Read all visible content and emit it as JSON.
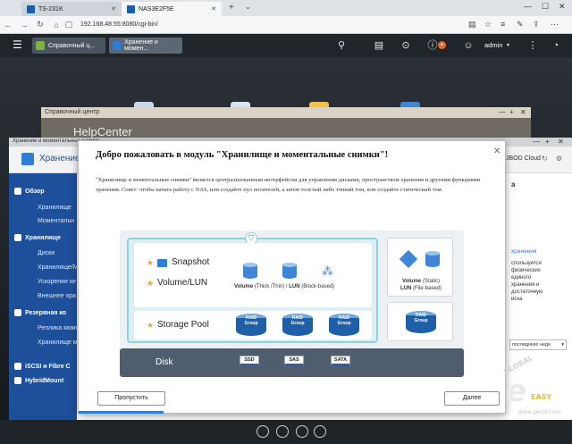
{
  "browser": {
    "tabs": [
      {
        "label": "TS-231K",
        "active": false
      },
      {
        "label": "NAS3E2F5E",
        "active": true
      }
    ],
    "address": "192.168.48.55:8080/cgi-bin/"
  },
  "qts": {
    "tabs": [
      "Справочный ц...",
      "Хранение и момен..."
    ],
    "user": "admin"
  },
  "help_window": {
    "header": "Справочный центр",
    "title": "HelpCenter"
  },
  "storage_window": {
    "header": "Хранение и моментальные снимки",
    "title": "Хранение",
    "jbod_label": "JBOD Cloud",
    "sidebar": {
      "items": [
        {
          "label": "Обзор",
          "type": "main"
        },
        {
          "label": "Хранилище",
          "type": "sub"
        },
        {
          "label": "Моментальн",
          "type": "sub"
        },
        {
          "label": "Хранилище",
          "type": "main"
        },
        {
          "label": "Диски",
          "type": "sub"
        },
        {
          "label": "Хранилище/М",
          "type": "sub"
        },
        {
          "label": "Ускорение ке",
          "type": "sub"
        },
        {
          "label": "Внешнее хра",
          "type": "sub"
        },
        {
          "label": "Резервная ко",
          "type": "main"
        },
        {
          "label": "Реплика момс",
          "type": "sub"
        },
        {
          "label": "Хранилище м",
          "type": "sub"
        },
        {
          "label": "iSCSI и Fibre C",
          "type": "main"
        },
        {
          "label": "HybridMount",
          "type": "main"
        }
      ]
    },
    "right_panel": {
      "heading": "а",
      "link": "хранения",
      "lines": [
        "спользуется",
        "физических",
        "единого",
        "хранения и",
        "достаточную",
        "иска"
      ],
      "select": "последнюю неде"
    }
  },
  "modal": {
    "title": "Добро пожаловать в модуль \"Хранилище и моментальные снимки\"!",
    "description": "\"Хранилище и моментальные снимки\" является централизованным интерфейсом для управления дисками, пространством хранения и другими функциями хранения. Совет: чтобы начать работу с NAS, или создайте пул носителей, а затем толстый либо тонкий том, или создайте статический том.",
    "diagram": {
      "snapshot_label": "Snapshot",
      "volume_lun_label": "Volume/LUN",
      "volume_caption_a": "Volume",
      "volume_caption_b": "(Thick /Thin) /",
      "volume_caption_c": "LUN",
      "volume_caption_d": "(Block-based)",
      "storage_pool_label": "Storage Pool",
      "raid_label_a": "RAID",
      "raid_label_b": "Group",
      "static_caption_a": "Volume",
      "static_caption_b": "(Static)",
      "static_caption_c": "LUN",
      "static_caption_d": "(File-based)",
      "disk_label": "Disk",
      "disk_types": [
        "SSD",
        "SAS",
        "SATA"
      ]
    },
    "skip_label": "Пропустить",
    "next_label": "Далее",
    "progress": 0.2
  },
  "watermark": {
    "arc": "GLOBAL",
    "brand": "EASY",
    "site": "www.gecid.com"
  },
  "colors": {
    "sidebar": "#1e4f9a",
    "accent": "#2f7dd6",
    "snap_border": "#8fd3d6"
  }
}
